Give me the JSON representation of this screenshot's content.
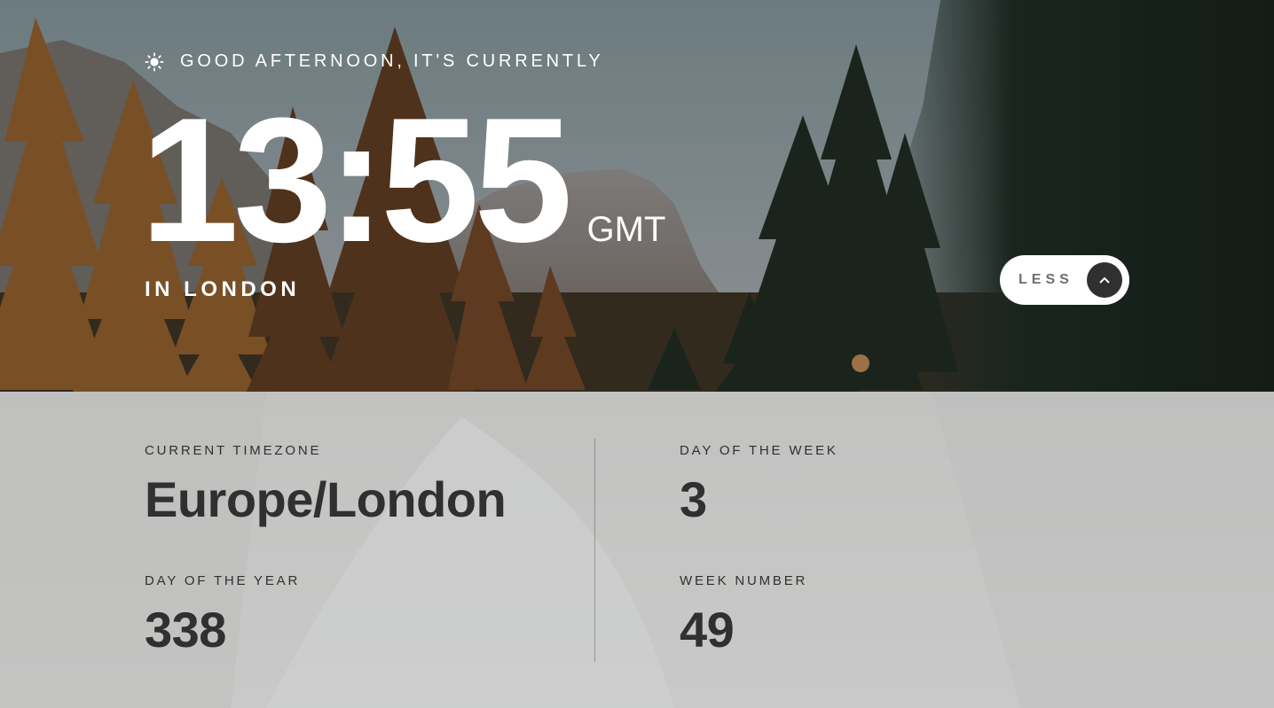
{
  "greeting": {
    "icon": "sun-icon",
    "text": "GOOD AFTERNOON, IT'S CURRENTLY"
  },
  "clock": {
    "time": "13:55",
    "abbreviation": "GMT",
    "location": "IN LONDON"
  },
  "toggle": {
    "label": "LESS",
    "icon": "chevron-up-icon"
  },
  "details": {
    "timezone_label": "CURRENT TIMEZONE",
    "timezone_value": "Europe/London",
    "day_of_year_label": "DAY OF THE YEAR",
    "day_of_year_value": "338",
    "day_of_week_label": "DAY OF THE WEEK",
    "day_of_week_value": "3",
    "week_number_label": "WEEK NUMBER",
    "week_number_value": "49"
  },
  "colors": {
    "text_light": "#ffffff",
    "text_dark": "#303030",
    "button_bg": "#ffffff",
    "button_icon_bg": "#303030",
    "panel_bg": "#d6d6d6"
  }
}
